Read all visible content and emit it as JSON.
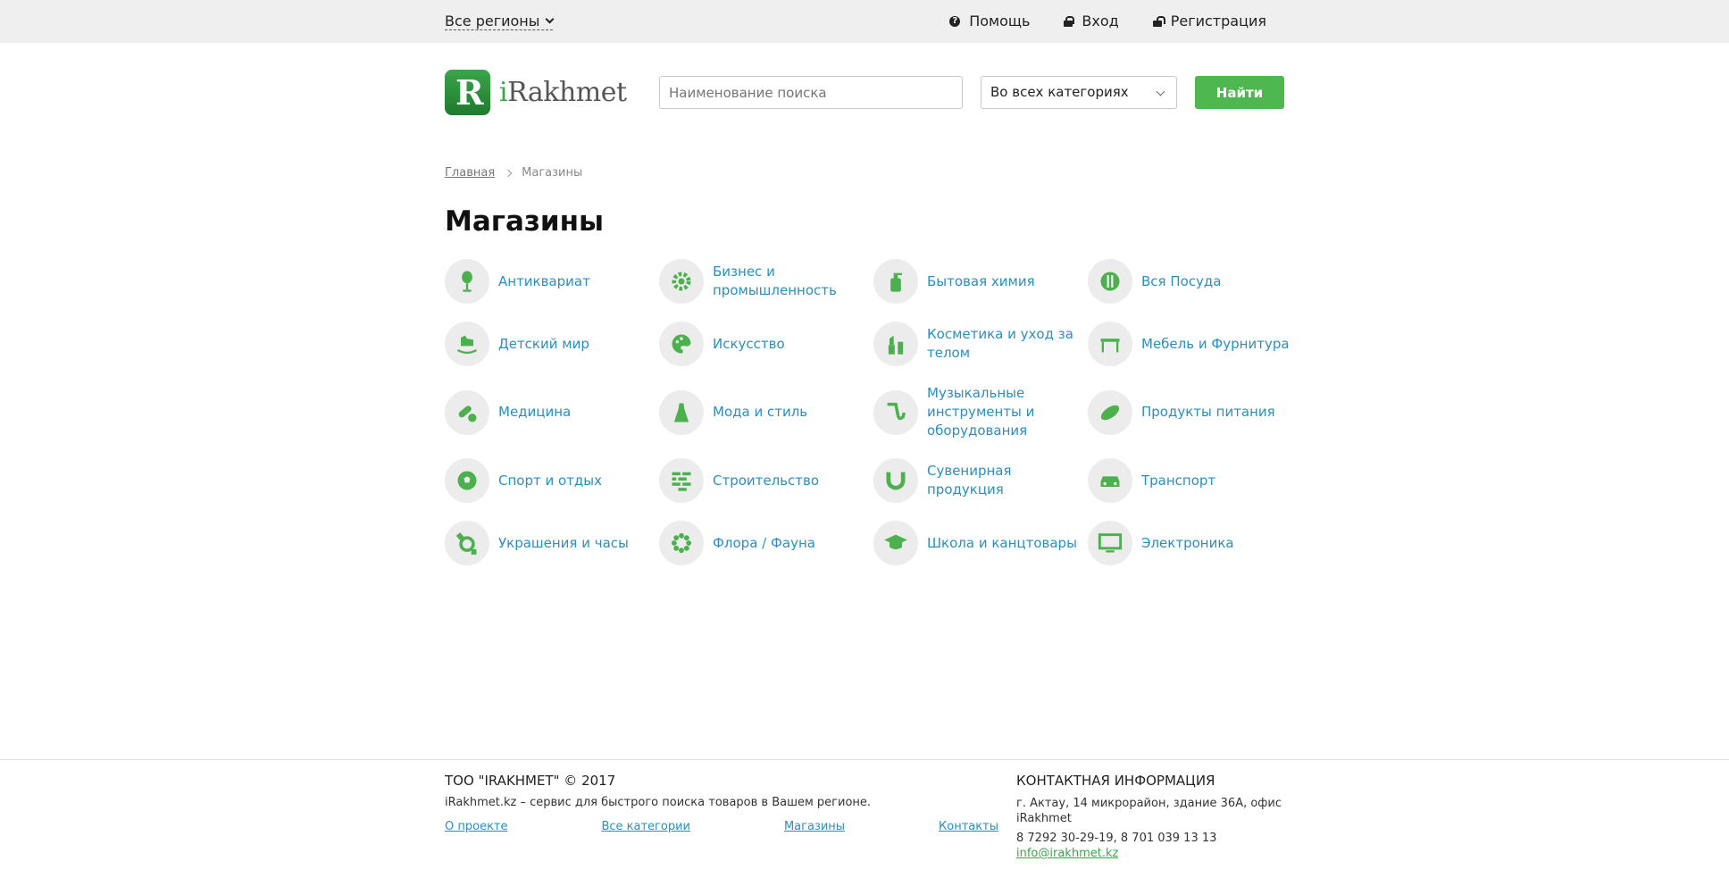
{
  "topbar": {
    "region": "Все регионы",
    "help": "Помощь",
    "login": "Вход",
    "register": "Регистрация"
  },
  "header": {
    "logo_text_i": "i",
    "logo_text_rest": "Rakhmet",
    "logo_mark": "R",
    "search_placeholder": "Наименование поиска",
    "category_select": "Во всех категориях",
    "find_button": "Найти"
  },
  "breadcrumb": {
    "home": "Главная",
    "current": "Магазины"
  },
  "page_title": "Магазины",
  "categories": [
    {
      "label": "Антиквариат",
      "icon": "gramophone-icon"
    },
    {
      "label": "Бизнес и промышленность",
      "icon": "gear-wrench-icon"
    },
    {
      "label": "Бытовая химия",
      "icon": "spray-bottle-icon"
    },
    {
      "label": "Вся Посуда",
      "icon": "plate-cutlery-icon"
    },
    {
      "label": "Детский мир",
      "icon": "rocking-horse-icon"
    },
    {
      "label": "Искусство",
      "icon": "palette-icon"
    },
    {
      "label": "Косметика и уход за телом",
      "icon": "lipstick-icon"
    },
    {
      "label": "Мебель и Фурнитура",
      "icon": "table-icon"
    },
    {
      "label": "Медицина",
      "icon": "pill-icon"
    },
    {
      "label": "Мода и стиль",
      "icon": "dress-icon"
    },
    {
      "label": "Музыкальные инструменты и оборудования",
      "icon": "saxophone-icon"
    },
    {
      "label": "Продукты питания",
      "icon": "bread-icon"
    },
    {
      "label": "Спорт и отдых",
      "icon": "soccer-ball-icon"
    },
    {
      "label": "Строительство",
      "icon": "bricks-icon"
    },
    {
      "label": "Сувенирная продукция",
      "icon": "horseshoe-icon"
    },
    {
      "label": "Транспорт",
      "icon": "car-icon"
    },
    {
      "label": "Украшения и часы",
      "icon": "watch-icon"
    },
    {
      "label": "Флора / Фауна",
      "icon": "flower-icon"
    },
    {
      "label": "Школа и канцтовары",
      "icon": "graduation-cap-icon"
    },
    {
      "label": "Электроника",
      "icon": "monitor-icon"
    }
  ],
  "footer": {
    "company": "ТОО \"IRAKHMET\" © 2017",
    "description": "iRakhmet.kz – сервис для быстрого поиска товаров в Вашем регионе.",
    "links": [
      "О проекте",
      "Все категории",
      "Магазины",
      "Контакты"
    ],
    "contact_heading": "Контактная информация",
    "address": "г. Актау, 14 микрорайон, здание 36А, офис iRakhmet",
    "phones": "8 7292 30-29-19, 8 701 039 13 13",
    "email": "info@irakhmet.kz"
  },
  "colors": {
    "accent_green": "#4fb750",
    "link_blue": "#2a8fbd",
    "topbar_bg": "#efefef"
  }
}
